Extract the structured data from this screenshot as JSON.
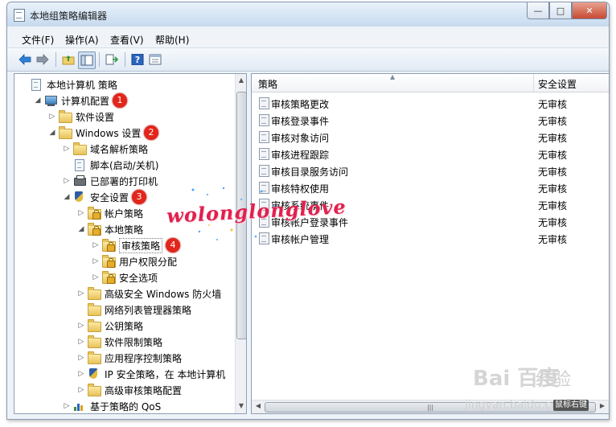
{
  "window": {
    "title": "本地组策略编辑器",
    "buttons": {
      "minimize": "—",
      "maximize": "□",
      "close": "✕"
    }
  },
  "menu": [
    "文件(F)",
    "操作(A)",
    "查看(V)",
    "帮助(H)"
  ],
  "toolbar": {
    "icons": [
      "back-arrow-icon",
      "forward-arrow-icon",
      "up-folder-icon",
      "show-hide-tree-icon",
      "export-list-icon",
      "help-icon",
      "properties-icon"
    ]
  },
  "tree": [
    {
      "label": "本地计算机 策略",
      "indent": 0,
      "expander": "",
      "icon": "docico"
    },
    {
      "label": "计算机配置",
      "indent": 1,
      "expander": "◢",
      "icon": "computer",
      "badge": "1"
    },
    {
      "label": "软件设置",
      "indent": 2,
      "expander": "▷",
      "icon": "folder"
    },
    {
      "label": "Windows 设置",
      "indent": 2,
      "expander": "◢",
      "icon": "folder",
      "badge": "2"
    },
    {
      "label": "域名解析策略",
      "indent": 3,
      "expander": "▷",
      "icon": "folder"
    },
    {
      "label": "脚本(启动/关机)",
      "indent": 3,
      "expander": "",
      "icon": "docico"
    },
    {
      "label": "已部署的打印机",
      "indent": 3,
      "expander": "▷",
      "icon": "printer"
    },
    {
      "label": "安全设置",
      "indent": 3,
      "expander": "◢",
      "icon": "shield",
      "badge": "3"
    },
    {
      "label": "帐户策略",
      "indent": 4,
      "expander": "▷",
      "icon": "lockfolder"
    },
    {
      "label": "本地策略",
      "indent": 4,
      "expander": "◢",
      "icon": "lockfolder"
    },
    {
      "label": "审核策略",
      "indent": 5,
      "expander": "▷",
      "icon": "lockfolder",
      "badge": "4",
      "selected": true
    },
    {
      "label": "用户权限分配",
      "indent": 5,
      "expander": "▷",
      "icon": "lockfolder"
    },
    {
      "label": "安全选项",
      "indent": 5,
      "expander": "▷",
      "icon": "lockfolder"
    },
    {
      "label": "高级安全 Windows 防火墙",
      "indent": 4,
      "expander": "▷",
      "icon": "folder"
    },
    {
      "label": "网络列表管理器策略",
      "indent": 4,
      "expander": "",
      "icon": "folder"
    },
    {
      "label": "公钥策略",
      "indent": 4,
      "expander": "▷",
      "icon": "folder"
    },
    {
      "label": "软件限制策略",
      "indent": 4,
      "expander": "▷",
      "icon": "folder"
    },
    {
      "label": "应用程序控制策略",
      "indent": 4,
      "expander": "▷",
      "icon": "folder"
    },
    {
      "label": "IP 安全策略，在 本地计算机",
      "indent": 4,
      "expander": "▷",
      "icon": "shield"
    },
    {
      "label": "高级审核策略配置",
      "indent": 4,
      "expander": "▷",
      "icon": "folder"
    },
    {
      "label": "基于策略的 QoS",
      "indent": 3,
      "expander": "▷",
      "icon": "chart"
    }
  ],
  "list": {
    "headers": {
      "policy": "策略",
      "setting": "安全设置"
    },
    "rows": [
      {
        "policy": "审核策略更改",
        "setting": "无审核"
      },
      {
        "policy": "审核登录事件",
        "setting": "无审核"
      },
      {
        "policy": "审核对象访问",
        "setting": "无审核"
      },
      {
        "policy": "审核进程跟踪",
        "setting": "无审核"
      },
      {
        "policy": "审核目录服务访问",
        "setting": "无审核"
      },
      {
        "policy": "审核特权使用",
        "setting": "无审核"
      },
      {
        "policy": "审核系统事件",
        "setting": "无审核"
      },
      {
        "policy": "审核帐户登录事件",
        "setting": "无审核"
      },
      {
        "policy": "审核帐户管理",
        "setting": "无审核"
      }
    ]
  },
  "watermark": "wolonglonglove",
  "baidu": {
    "logo": "Bai 百度",
    "jingyan": "经验",
    "url": "jingyan.baidu.com",
    "tooltip": "鼠标右键"
  }
}
